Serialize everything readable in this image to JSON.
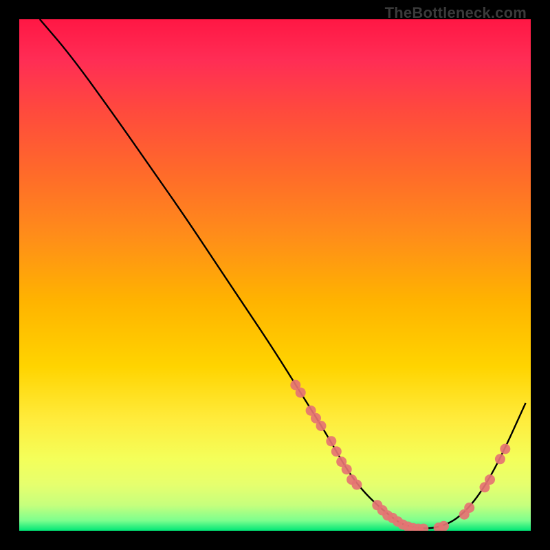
{
  "watermark": {
    "text": "TheBottleneck.com"
  },
  "chart_data": {
    "type": "line",
    "title": "",
    "xlabel": "",
    "ylabel": "",
    "xlim": [
      0,
      100
    ],
    "ylim": [
      0,
      100
    ],
    "series": [
      {
        "name": "curve",
        "x": [
          4,
          10,
          18,
          25,
          32,
          38,
          44,
          50,
          55,
          60,
          64,
          67,
          70,
          73,
          75,
          78,
          82,
          86,
          90,
          94,
          99
        ],
        "y": [
          100,
          93,
          82,
          72,
          62,
          53,
          44,
          35,
          27,
          19,
          12,
          8,
          5,
          2.5,
          1.2,
          0.4,
          0.6,
          2.5,
          7,
          14,
          25
        ]
      }
    ],
    "markers": [
      {
        "x": 54,
        "y": 28.5
      },
      {
        "x": 55,
        "y": 27
      },
      {
        "x": 57,
        "y": 23.5
      },
      {
        "x": 58,
        "y": 22
      },
      {
        "x": 59,
        "y": 20.5
      },
      {
        "x": 61,
        "y": 17.5
      },
      {
        "x": 62,
        "y": 15.5
      },
      {
        "x": 63,
        "y": 13.5
      },
      {
        "x": 64,
        "y": 12
      },
      {
        "x": 65,
        "y": 10
      },
      {
        "x": 66,
        "y": 9
      },
      {
        "x": 70,
        "y": 5
      },
      {
        "x": 71,
        "y": 4
      },
      {
        "x": 72,
        "y": 3
      },
      {
        "x": 73,
        "y": 2.5
      },
      {
        "x": 74,
        "y": 1.8
      },
      {
        "x": 75,
        "y": 1.2
      },
      {
        "x": 76,
        "y": 0.8
      },
      {
        "x": 77,
        "y": 0.5
      },
      {
        "x": 78,
        "y": 0.4
      },
      {
        "x": 79,
        "y": 0.4
      },
      {
        "x": 82,
        "y": 0.6
      },
      {
        "x": 83,
        "y": 0.9
      },
      {
        "x": 87,
        "y": 3.2
      },
      {
        "x": 88,
        "y": 4.5
      },
      {
        "x": 91,
        "y": 8.5
      },
      {
        "x": 92,
        "y": 10
      },
      {
        "x": 94,
        "y": 14
      },
      {
        "x": 95,
        "y": 16
      }
    ],
    "marker_color": "#e57373",
    "curve_color": "#000000"
  }
}
